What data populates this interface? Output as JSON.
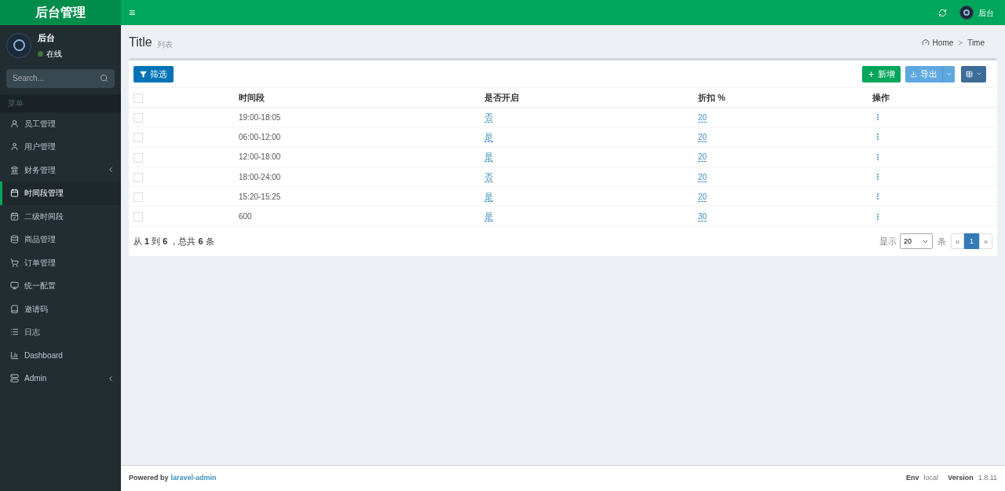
{
  "header": {
    "logo": "后台管理",
    "menu_toggle": "≡",
    "user_name": "后台"
  },
  "sidebar": {
    "user": {
      "name": "后台",
      "status": "在线",
      "online": true
    },
    "search": {
      "placeholder": "Search..."
    },
    "section": "菜单",
    "items": [
      {
        "label": "员工管理",
        "selected": false,
        "expandable": false
      },
      {
        "label": "用户管理",
        "selected": false,
        "expandable": false
      },
      {
        "label": "财务管理",
        "selected": false,
        "expandable": true
      },
      {
        "label": "时间段管理",
        "selected": true,
        "expandable": false
      },
      {
        "label": "二级时间段",
        "selected": false,
        "expandable": false
      },
      {
        "label": "商品管理",
        "selected": false,
        "expandable": false
      },
      {
        "label": "订单管理",
        "selected": false,
        "expandable": false
      },
      {
        "label": "统一配置",
        "selected": false,
        "expandable": false
      },
      {
        "label": "邀请码",
        "selected": false,
        "expandable": false
      },
      {
        "label": "日志",
        "selected": false,
        "expandable": false
      },
      {
        "label": "Dashboard",
        "selected": false,
        "expandable": false
      },
      {
        "label": "Admin",
        "selected": false,
        "expandable": true
      }
    ]
  },
  "page": {
    "title": "Title",
    "subtitle": "列表",
    "breadcrumb": [
      "Home",
      "Time"
    ],
    "breadcrumb_separator": ">"
  },
  "toolbar": {
    "filter": "筛选",
    "create": "新增",
    "export": "导出"
  },
  "table": {
    "select_all_checked": false,
    "columns": [
      "时间段",
      "是否开启",
      "折扣 %",
      "操作"
    ],
    "rows": [
      {
        "checked": false,
        "period": "19:00-18:05",
        "enabled": "否",
        "discount": "20"
      },
      {
        "checked": false,
        "period": "06:00-12:00",
        "enabled": "是",
        "discount": "20"
      },
      {
        "checked": false,
        "period": "12:00-18:00",
        "enabled": "是",
        "discount": "20"
      },
      {
        "checked": false,
        "period": "18:00-24:00",
        "enabled": "否",
        "discount": "20"
      },
      {
        "checked": false,
        "period": "15:20-15:25",
        "enabled": "是",
        "discount": "20"
      },
      {
        "checked": false,
        "period": "600",
        "enabled": "是",
        "discount": "30"
      }
    ]
  },
  "pagination": {
    "summary": "从 **1** 到 **6** ，总共 **6** 条",
    "show_label": "显示",
    "per_page": "20",
    "unit": "条",
    "prev": "«",
    "pages": [
      {
        "label": "1",
        "selected": true
      }
    ],
    "next": "»"
  },
  "footer": {
    "powered_by": "Powered by",
    "link": "laravel-admin",
    "env_label": "Env",
    "env": "local",
    "version_label": "Version",
    "version": "1.8.11"
  }
}
